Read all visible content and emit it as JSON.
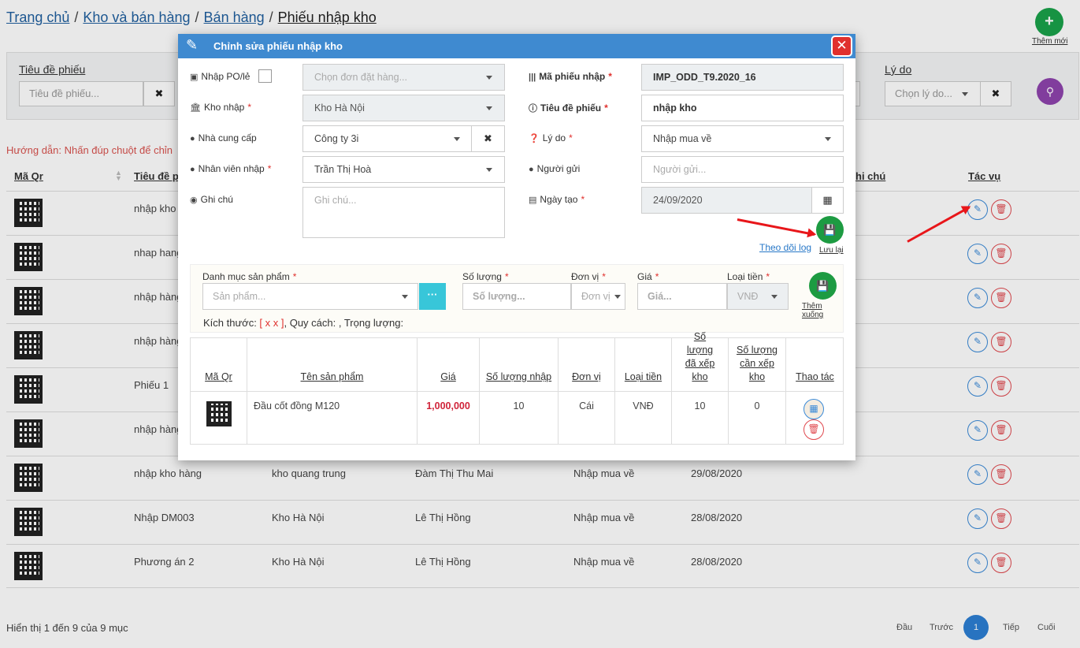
{
  "breadcrumb": {
    "home": "Trang chủ",
    "warehouse": "Kho và bán hàng",
    "sales": "Bán hàng",
    "current": "Phiếu nhập kho",
    "sep": "/"
  },
  "add_new_label": "Thêm mới",
  "filters": {
    "title_label": "Tiêu đề phiếu",
    "title_placeholder": "Tiêu đề phiếu...",
    "reason_label": "Lý do",
    "reason_placeholder": "Chọn lý do..."
  },
  "hint": "Hướng dẫn: Nhấn đúp chuột để chỉn",
  "table": {
    "headers": {
      "qr": "Mã Qr",
      "title": "Tiêu đề p",
      "note": "hi chú",
      "actions": "Tác vụ"
    },
    "rows": [
      {
        "title": "nhập kho",
        "warehouse": "",
        "staff": "",
        "reason": "",
        "date": ""
      },
      {
        "title": "nhap hang",
        "warehouse": "",
        "staff": "",
        "reason": "",
        "date": ""
      },
      {
        "title": "nhập hàng",
        "warehouse": "",
        "staff": "",
        "reason": "",
        "date": ""
      },
      {
        "title": "nhập hàng",
        "warehouse": "",
        "staff": "",
        "reason": "",
        "date": ""
      },
      {
        "title": "Phiếu 1",
        "warehouse": "",
        "staff": "",
        "reason": "",
        "date": ""
      },
      {
        "title": "nhập hàng",
        "warehouse": "",
        "staff": "",
        "reason": "",
        "date": ""
      },
      {
        "title": "nhập kho hàng",
        "warehouse": "kho quang trung",
        "staff": "Đàm Thị Thu Mai",
        "reason": "Nhập mua về",
        "date": "29/08/2020"
      },
      {
        "title": "Nhập DM003",
        "warehouse": "Kho Hà Nội",
        "staff": "Lê Thị Hồng",
        "reason": "Nhập mua về",
        "date": "28/08/2020"
      },
      {
        "title": "Phương án 2",
        "warehouse": "Kho Hà Nội",
        "staff": "Lê Thị Hồng",
        "reason": "Nhập mua về",
        "date": "28/08/2020"
      }
    ]
  },
  "footer": {
    "info": "Hiển thị 1 đến 9 của 9 mục",
    "first": "Đầu",
    "prev": "Trước",
    "current_page": "1",
    "next": "Tiếp",
    "last": "Cuối"
  },
  "modal": {
    "title": "Chỉnh sửa phiếu nhập kho",
    "po_label": "Nhập PO/lẻ",
    "order_placeholder": "Chọn đơn đặt hàng...",
    "receipt_code_label": "Mã phiếu nhập",
    "receipt_code_value": "IMP_ODD_T9.2020_16",
    "warehouse_label": "Kho nhập",
    "warehouse_value": "Kho Hà Nội",
    "title_label": "Tiêu đề phiếu",
    "title_value": "nhập kho",
    "supplier_label": "Nhà cung cấp",
    "supplier_value": "Công ty 3i",
    "reason_label": "Lý do",
    "reason_value": "Nhập mua về",
    "staff_label": "Nhân viên nhập",
    "staff_value": "Trần Thị Hoà",
    "sender_label": "Người gửi",
    "sender_placeholder": "Người gửi...",
    "note_label": "Ghi chú",
    "note_placeholder": "Ghi chú...",
    "date_label": "Ngày tạo",
    "date_value": "24/09/2020",
    "save_label": "Lưu lại",
    "log_link": "Theo dõi log",
    "required_mark": "*"
  },
  "product_form": {
    "category_label": "Danh mục sản phẩm",
    "product_placeholder": "Sản phẩm...",
    "qty_label": "Số lượng",
    "qty_placeholder": "Số lượng...",
    "unit_label": "Đơn vị",
    "unit_placeholder": "Đơn vị",
    "price_label": "Giá",
    "price_placeholder": "Giá...",
    "currency_label": "Loại tiền",
    "currency_value": "VNĐ",
    "add_label": "Thêm xuống",
    "dims_prefix": "Kích thước: ",
    "dims_value": "[ x x ]",
    "dims_suffix": ", Quy cách: , Trọng lượng:"
  },
  "product_table": {
    "headers": {
      "qr": "Mã Qr",
      "name": "Tên sản phẩm",
      "price": "Giá",
      "qty": "Số lượng nhập",
      "unit": "Đơn vị",
      "currency": "Loại tiền",
      "stocked": "Số lượng đã xếp kho",
      "to_stock": "Số lượng cần xếp kho",
      "actions": "Thao tác"
    },
    "rows": [
      {
        "name": "Đầu cốt đồng M120",
        "price": "1,000,000",
        "qty": "10",
        "unit": "Cái",
        "currency": "VNĐ",
        "stocked": "10",
        "to_stock": "0"
      }
    ]
  },
  "colors": {
    "header_blue": "#3f8ad0",
    "save_green": "#1d9b42",
    "danger_red": "#e0302d",
    "search_purple": "#8e44ad"
  }
}
